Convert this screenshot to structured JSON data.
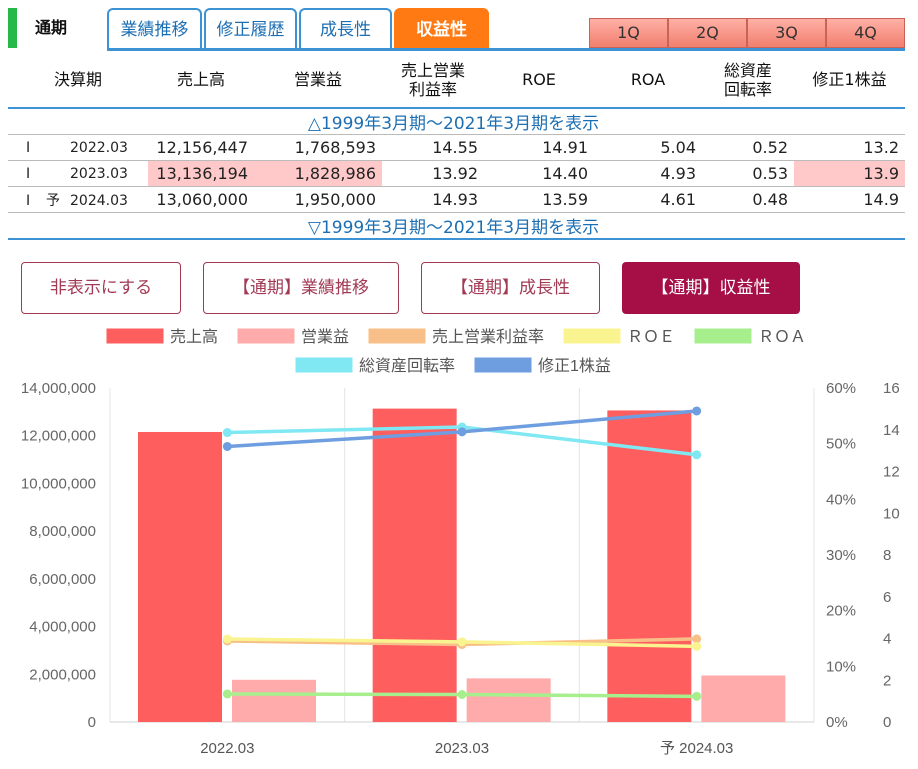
{
  "header": {
    "period": "通期",
    "tabs": [
      {
        "label": "業績推移",
        "active": false
      },
      {
        "label": "修正履歴",
        "active": false
      },
      {
        "label": "成長性",
        "active": false
      },
      {
        "label": "収益性",
        "active": true
      }
    ],
    "quarters": [
      "1Q",
      "2Q",
      "3Q",
      "4Q"
    ]
  },
  "table": {
    "columns": [
      "決算期",
      "売上高",
      "営業益",
      "売上営業\n利益率",
      "ROE",
      "ROA",
      "総資産\n回転率",
      "修正1株益"
    ],
    "toggle_top": "△1999年3月期～2021年3月期を表示",
    "toggle_bottom": "▽1999年3月期～2021年3月期を表示",
    "rows": [
      {
        "flag": "I",
        "mark": "",
        "period": "2022.03",
        "sales": "12,156,447",
        "op": "1,768,593",
        "margin": "14.55",
        "roe": "14.91",
        "roa": "5.04",
        "turnover": "0.52",
        "eps": "13.2",
        "highlight": []
      },
      {
        "flag": "I",
        "mark": "",
        "period": "2023.03",
        "sales": "13,136,194",
        "op": "1,828,986",
        "margin": "13.92",
        "roe": "14.40",
        "roa": "4.93",
        "turnover": "0.53",
        "eps": "13.9",
        "highlight": [
          "sales",
          "op",
          "eps"
        ]
      },
      {
        "flag": "I",
        "mark": "予",
        "period": "2024.03",
        "sales": "13,060,000",
        "op": "1,950,000",
        "margin": "14.93",
        "roe": "13.59",
        "roa": "4.61",
        "turnover": "0.48",
        "eps": "14.9",
        "highlight": []
      }
    ]
  },
  "chart_buttons": [
    {
      "label": "非表示にする",
      "active": false
    },
    {
      "label": "【通期】業績推移",
      "active": false
    },
    {
      "label": "【通期】成長性",
      "active": false
    },
    {
      "label": "【通期】収益性",
      "active": true
    }
  ],
  "chart_data": {
    "type": "bar",
    "categories": [
      "2022.03",
      "2023.03",
      "予 2024.03"
    ],
    "series": [
      {
        "name": "売上高",
        "kind": "bar",
        "axis": "left",
        "color": "#ff5e5e",
        "values": [
          12156447,
          13136194,
          13060000
        ]
      },
      {
        "name": "営業益",
        "kind": "bar",
        "axis": "left",
        "color": "#ffabab",
        "values": [
          1768593,
          1828986,
          1950000
        ]
      },
      {
        "name": "売上営業利益率",
        "kind": "line",
        "axis": "pct",
        "color": "#f8c088",
        "values": [
          14.55,
          13.92,
          14.93
        ]
      },
      {
        "name": "ＲＯＥ",
        "kind": "line",
        "axis": "pct",
        "color": "#f9f490",
        "values": [
          14.91,
          14.4,
          13.59
        ]
      },
      {
        "name": "ＲＯＡ",
        "kind": "line",
        "axis": "pct",
        "color": "#a7ef8c",
        "values": [
          5.04,
          4.93,
          4.61
        ]
      },
      {
        "name": "総資産回転率",
        "kind": "line",
        "axis": "right",
        "color": "#80e8f2",
        "values": [
          0.52,
          0.53,
          0.48
        ]
      },
      {
        "name": "修正1株益",
        "kind": "line",
        "axis": "right",
        "color": "#6f9ee0",
        "values": [
          13.2,
          13.9,
          14.9
        ]
      }
    ],
    "left_axis": {
      "ylim": [
        0,
        14000000
      ],
      "ticks": [
        "0",
        "2,000,000",
        "4,000,000",
        "6,000,000",
        "8,000,000",
        "10,000,000",
        "12,000,000",
        "14,000,000"
      ]
    },
    "pct_axis": {
      "ylim": [
        0,
        60
      ],
      "ticks": [
        "0%",
        "10%",
        "20%",
        "30%",
        "40%",
        "50%",
        "60%"
      ]
    },
    "right_axis": {
      "ylim": [
        0,
        16
      ],
      "ticks": [
        "0",
        "2",
        "4",
        "6",
        "8",
        "10",
        "12",
        "14",
        "16"
      ]
    },
    "legend_placement": "top",
    "grid": true
  }
}
